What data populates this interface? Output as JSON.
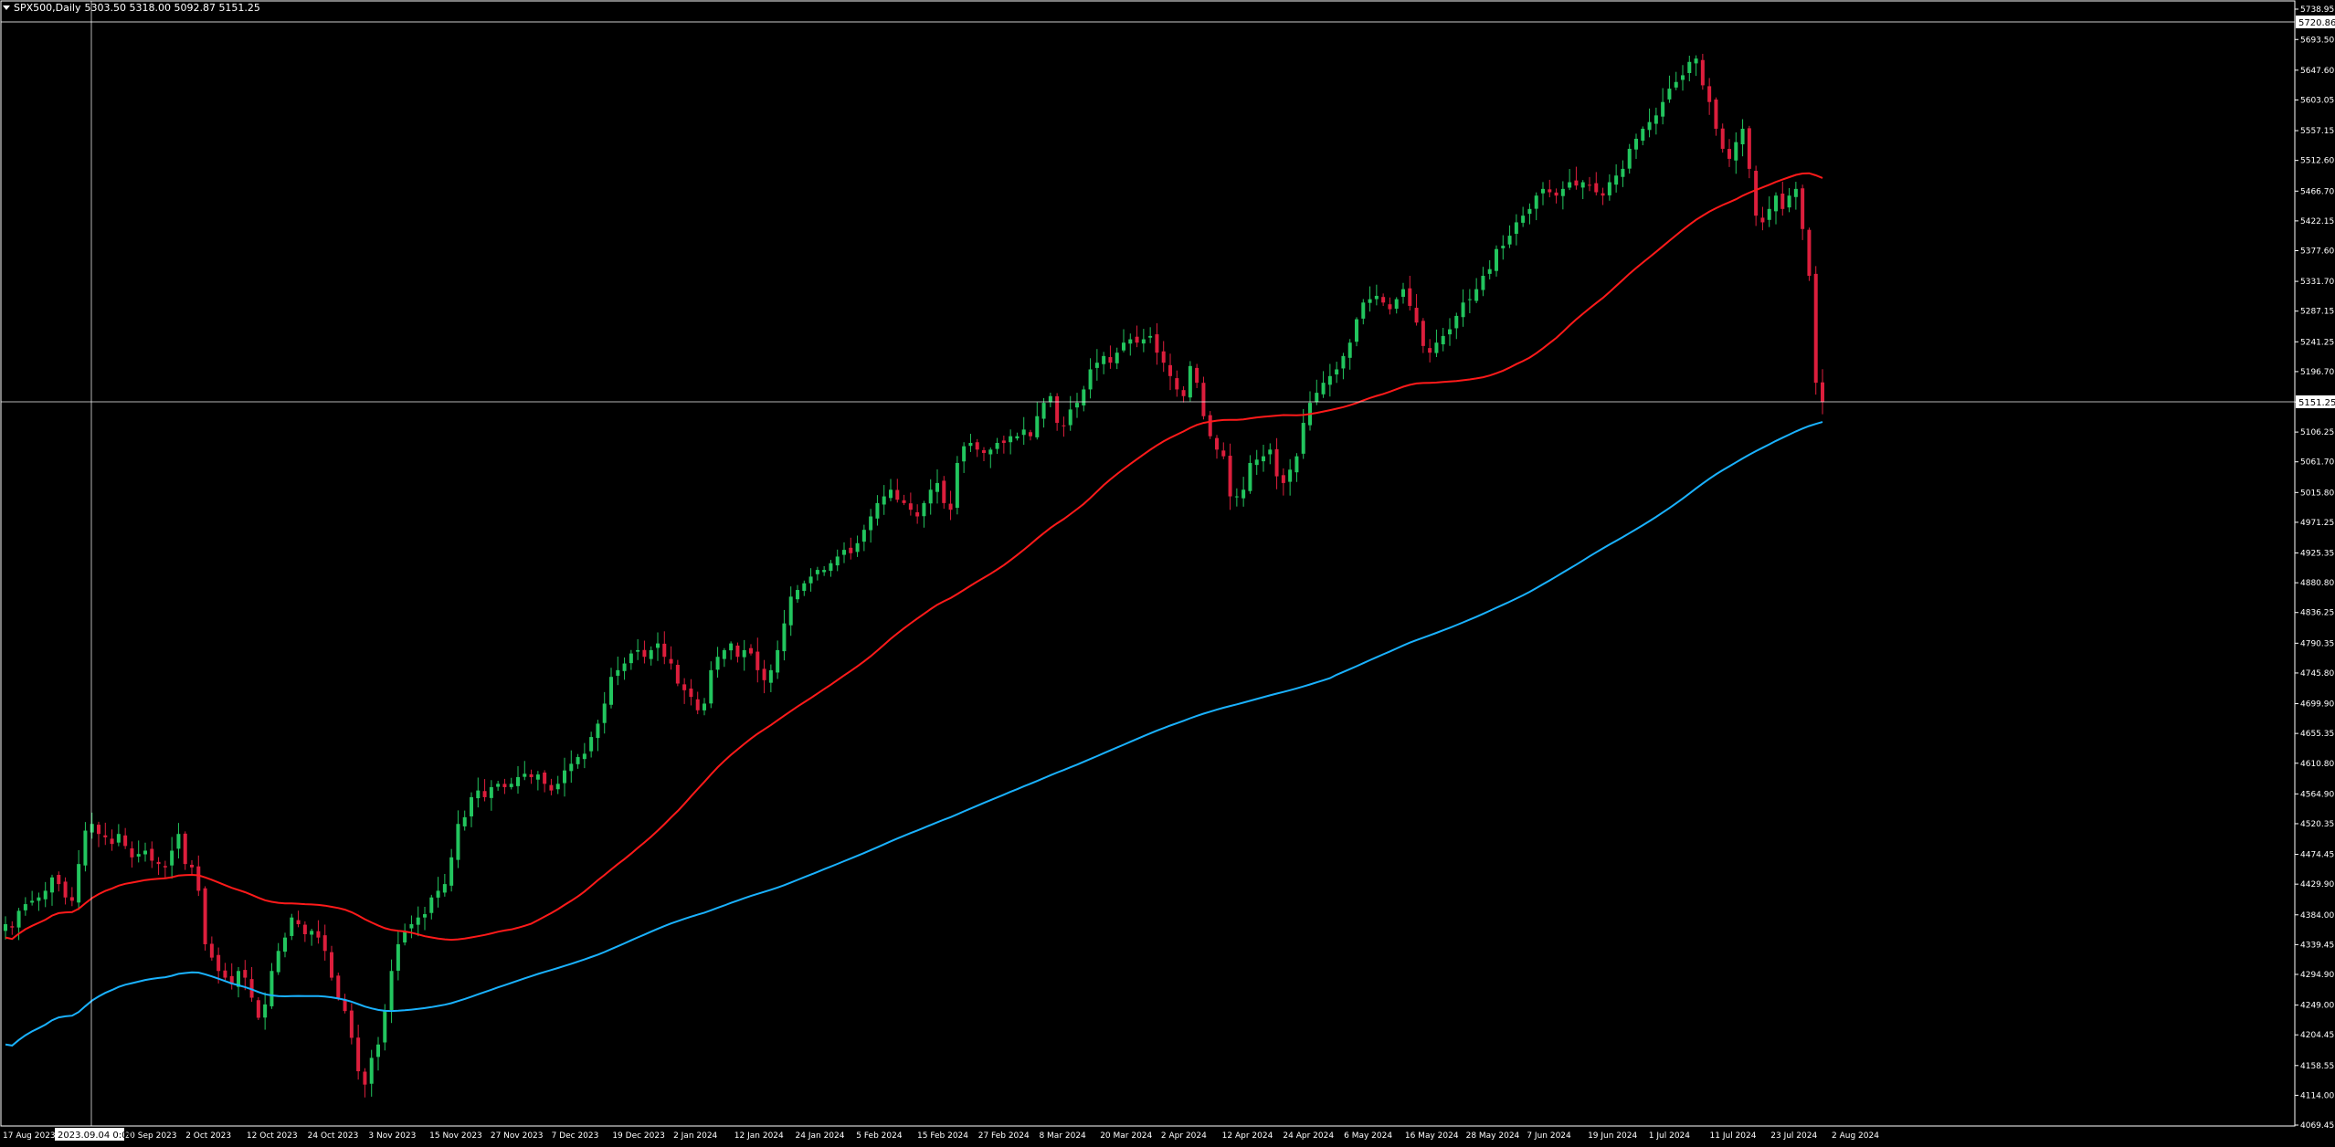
{
  "header": {
    "symbol": "SPX500,Daily",
    "ohlc": "5303.50 5318.00 5092.87 5151.25"
  },
  "colors": {
    "background": "#000000",
    "frame": "#ffffff",
    "bull": "#22c55e",
    "bear": "#dc1e3c",
    "ma_fast": "#ff1a1a",
    "ma_slow": "#1ab2ff",
    "text": "#ffffff",
    "price_tag_bg": "#ffffff",
    "price_tag_text": "#000000"
  },
  "crosshair": {
    "price_tag": "5151.25",
    "date_tag": "2023.09.04 0:00",
    "top_tag": "5720.86"
  },
  "chart_data": {
    "type": "candlestick",
    "title": "SPX500,Daily",
    "ylim": [
      4069.45,
      5738.95
    ],
    "y_ticks": [
      "5738.95",
      "5693.50",
      "5647.60",
      "5603.05",
      "5557.15",
      "5512.60",
      "5466.70",
      "5422.15",
      "5377.60",
      "5331.70",
      "5287.15",
      "5241.25",
      "5196.70",
      "5151.25",
      "5106.25",
      "5061.70",
      "5015.80",
      "4971.25",
      "4925.35",
      "4880.80",
      "4836.25",
      "4790.35",
      "4745.80",
      "4699.90",
      "4655.35",
      "4610.80",
      "4564.90",
      "4520.35",
      "4474.45",
      "4429.90",
      "4384.00",
      "4339.45",
      "4294.90",
      "4249.00",
      "4204.45",
      "4158.55",
      "4114.00",
      "4069.45"
    ],
    "x_ticks": [
      "17 Aug 2023",
      "2023.09.04 0:00",
      "Sep 2023",
      "20 Sep 2023",
      "2 Oct 2023",
      "12 Oct 2023",
      "24 Oct 2023",
      "3 Nov 2023",
      "15 Nov 2023",
      "27 Nov 2023",
      "7 Dec 2023",
      "19 Dec 2023",
      "2 Jan 2024",
      "12 Jan 2024",
      "24 Jan 2024",
      "5 Feb 2024",
      "15 Feb 2024",
      "27 Feb 2024",
      "8 Mar 2024",
      "20 Mar 2024",
      "2 Apr 2024",
      "12 Apr 2024",
      "24 Apr 2024",
      "6 May 2024",
      "16 May 2024",
      "28 May 2024",
      "7 Jun 2024",
      "19 Jun 2024",
      "1 Jul 2024",
      "11 Jul 2024",
      "23 Jul 2024",
      "2 Aug 2024"
    ],
    "closes": [
      4370,
      4365,
      4390,
      4400,
      4405,
      4410,
      4420,
      4440,
      4430,
      4410,
      4405,
      4460,
      4510,
      4520,
      4505,
      4500,
      4490,
      4505,
      4487,
      4470,
      4475,
      4480,
      4465,
      4460,
      4455,
      4480,
      4505,
      4460,
      4455,
      4420,
      4340,
      4320,
      4300,
      4290,
      4280,
      4300,
      4290,
      4260,
      4230,
      4250,
      4300,
      4330,
      4350,
      4380,
      4370,
      4355,
      4360,
      4350,
      4330,
      4290,
      4260,
      4240,
      4200,
      4150,
      4130,
      4170,
      4190,
      4240,
      4300,
      4340,
      4360,
      4370,
      4380,
      4385,
      4410,
      4420,
      4430,
      4470,
      4520,
      4530,
      4560,
      4570,
      4560,
      4575,
      4580,
      4575,
      4580,
      4590,
      4595,
      4590,
      4594,
      4580,
      4570,
      4580,
      4600,
      4610,
      4620,
      4625,
      4650,
      4670,
      4700,
      4740,
      4750,
      4760,
      4775,
      4780,
      4770,
      4780,
      4790,
      4770,
      4760,
      4730,
      4720,
      4710,
      4690,
      4700,
      4750,
      4770,
      4780,
      4790,
      4770,
      4780,
      4775,
      4750,
      4735,
      4750,
      4780,
      4820,
      4860,
      4870,
      4880,
      4890,
      4900,
      4900,
      4910,
      4920,
      4930,
      4925,
      4940,
      4960,
      4980,
      5000,
      5010,
      5020,
      5005,
      5000,
      4990,
      4980,
      5000,
      5020,
      5030,
      5000,
      4990,
      5060,
      5085,
      5090,
      5080,
      5075,
      5080,
      5090,
      5090,
      5100,
      5100,
      5110,
      5100,
      5130,
      5150,
      5160,
      5120,
      5115,
      5140,
      5150,
      5170,
      5200,
      5210,
      5220,
      5210,
      5225,
      5240,
      5245,
      5240,
      5245,
      5250,
      5225,
      5210,
      5190,
      5170,
      5160,
      5205,
      5180,
      5130,
      5100,
      5080,
      5070,
      5010,
      5010,
      5020,
      5060,
      5065,
      5070,
      5080,
      5040,
      5030,
      5050,
      5070,
      5120,
      5150,
      5165,
      5180,
      5190,
      5200,
      5220,
      5240,
      5275,
      5300,
      5305,
      5310,
      5300,
      5290,
      5305,
      5320,
      5295,
      5270,
      5235,
      5225,
      5240,
      5250,
      5260,
      5280,
      5300,
      5305,
      5320,
      5340,
      5350,
      5380,
      5385,
      5400,
      5420,
      5430,
      5440,
      5460,
      5470,
      5465,
      5460,
      5470,
      5480,
      5475,
      5480,
      5475,
      5465,
      5460,
      5480,
      5490,
      5500,
      5530,
      5545,
      5560,
      5570,
      5580,
      5600,
      5620,
      5630,
      5640,
      5660,
      5665,
      5625,
      5600,
      5560,
      5530,
      5515,
      5540,
      5560,
      5500,
      5430,
      5420,
      5440,
      5460,
      5440,
      5460,
      5470,
      5410,
      5340,
      5180,
      5151.25
    ],
    "series": [
      {
        "name": "",
        "kind": "ma_fast"
      },
      {
        "name": "",
        "kind": "ma_slow"
      }
    ],
    "last_price": 5151.25,
    "grid": false
  }
}
